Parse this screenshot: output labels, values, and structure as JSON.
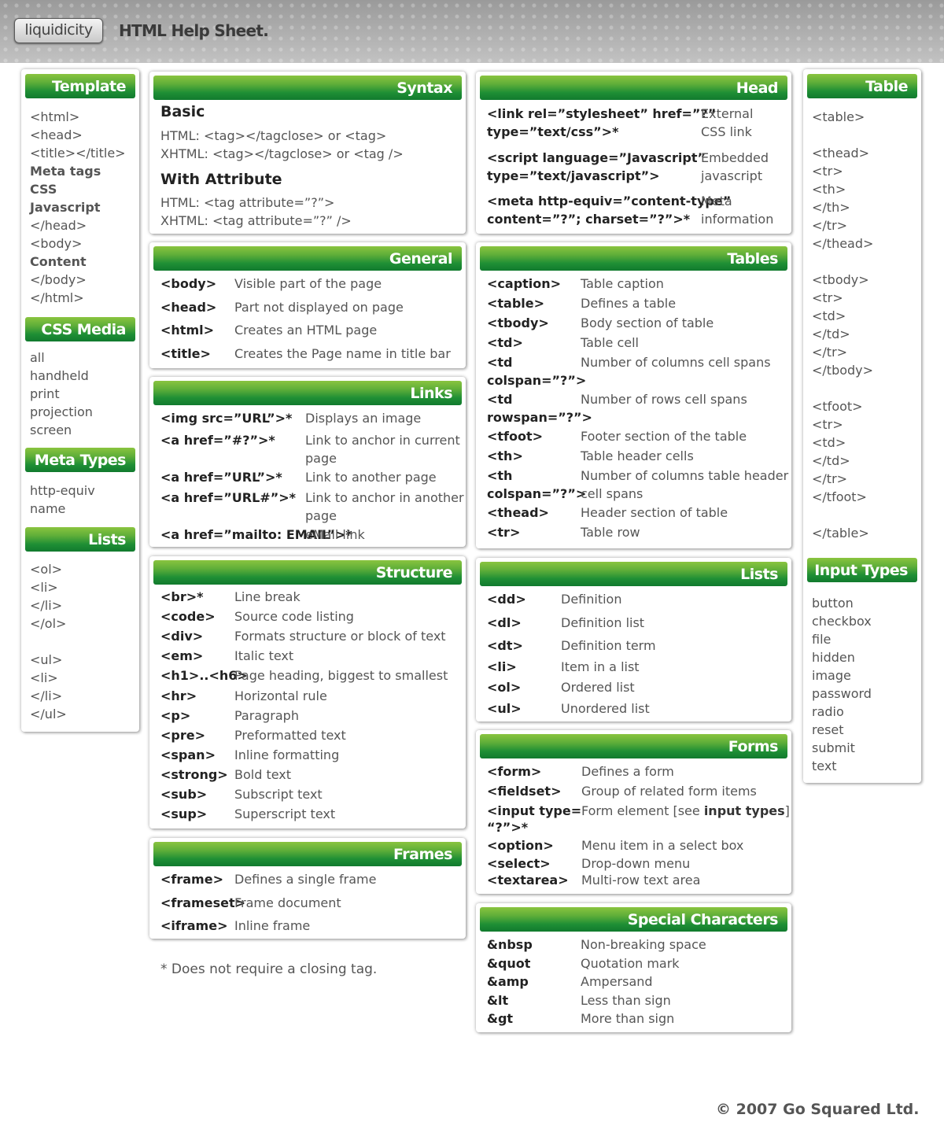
{
  "header": {
    "logo": "liquidicity",
    "title": "HTML Help Sheet."
  },
  "template": {
    "title": "Template",
    "items": [
      {
        "text": "<html>",
        "bold": false
      },
      {
        "text": "<head>",
        "bold": false
      },
      {
        "text": "<title></title>",
        "bold": false
      },
      {
        "text": "Meta tags",
        "bold": true
      },
      {
        "text": "CSS",
        "bold": true
      },
      {
        "text": "Javascript",
        "bold": true
      },
      {
        "text": "</head>",
        "bold": false
      },
      {
        "text": "<body>",
        "bold": false
      },
      {
        "text": "Content",
        "bold": true
      },
      {
        "text": "</body>",
        "bold": false
      },
      {
        "text": "</html>",
        "bold": false
      }
    ]
  },
  "css_media": {
    "title": "CSS Media",
    "items": [
      "all",
      "handheld",
      "print",
      "projection",
      "screen"
    ]
  },
  "meta_types": {
    "title": "Meta Types",
    "items": [
      "http-equiv",
      "name"
    ]
  },
  "lists_left": {
    "title": "Lists",
    "items": [
      "<ol>",
      "<li>",
      "</li>",
      "</ol>",
      "",
      "<ul>",
      "<li>",
      "</li>",
      "</ul>"
    ]
  },
  "syntax": {
    "title": "Syntax",
    "basic_heading": "Basic",
    "basic": [
      "HTML: <tag></tagclose> or <tag>",
      "XHTML: <tag></tagclose> or <tag />"
    ],
    "attr_heading": "With Attribute",
    "attr": [
      "HTML: <tag attribute=”?”>",
      "XHTML: <tag attribute=”?” />"
    ]
  },
  "general": {
    "title": "General",
    "rows": [
      {
        "tag": "<body>",
        "desc": "Visible part of the page"
      },
      {
        "tag": "<head>",
        "desc": "Part not displayed on page"
      },
      {
        "tag": "<html>",
        "desc": "Creates an HTML page"
      },
      {
        "tag": "<title>",
        "desc": "Creates the Page name in title bar"
      }
    ]
  },
  "links": {
    "title": "Links",
    "rows": [
      {
        "tag": "<img src=”URL”>*",
        "desc": "Displays an image"
      },
      {
        "tag": "<a href=”#?”>*",
        "desc": "Link to anchor in current",
        "desc2": "page"
      },
      {
        "tag": "<a href=”URL”>*",
        "desc": "Link to another page"
      },
      {
        "tag": "<a href=”URL#”>*",
        "desc": "Link to anchor in another",
        "desc2": "page"
      },
      {
        "tag": "<a href=”mailto: EMAIL”>*",
        "desc": "eMail link"
      }
    ]
  },
  "structure": {
    "title": "Structure",
    "rows": [
      {
        "tag": "<br>*",
        "desc": "Line break"
      },
      {
        "tag": "<code>",
        "desc": "Source code listing"
      },
      {
        "tag": "<div>",
        "desc": "Formats structure or block of text"
      },
      {
        "tag": "<em>",
        "desc": "Italic text"
      },
      {
        "tag": "<h1>..<h6>",
        "desc": "Page heading, biggest to smallest"
      },
      {
        "tag": "<hr>",
        "desc": "Horizontal rule"
      },
      {
        "tag": "<p>",
        "desc": "Paragraph"
      },
      {
        "tag": "<pre>",
        "desc": "Preformatted text"
      },
      {
        "tag": "<span>",
        "desc": "Inline formatting"
      },
      {
        "tag": "<strong>",
        "desc": "Bold text"
      },
      {
        "tag": "<sub>",
        "desc": "Subscript text"
      },
      {
        "tag": "<sup>",
        "desc": "Superscript text"
      }
    ]
  },
  "frames": {
    "title": "Frames",
    "rows": [
      {
        "tag": "<frame>",
        "desc": "Defines a single frame"
      },
      {
        "tag": "<frameset>",
        "desc": "Frame document"
      },
      {
        "tag": "<iframe>",
        "desc": "Inline frame"
      }
    ]
  },
  "footnote": "* Does not require a closing tag.",
  "head": {
    "title": "Head",
    "rows": [
      {
        "tag": "<link rel=”stylesheet” href=”?”",
        "tag2": "type=”text/css”>*",
        "desc": "External",
        "desc2": "CSS link"
      },
      {
        "tag": "<script language=”Javascript”",
        "tag2": "type=”text/javascript”>",
        "desc": "Embedded",
        "desc2": "javascript"
      },
      {
        "tag": "<meta http-equiv=”content-type”",
        "tag2": "content=”?”; charset=”?”>*",
        "desc": "Meta",
        "desc2": "information"
      }
    ]
  },
  "tables": {
    "title": "Tables",
    "rows": [
      {
        "tag": "<caption>",
        "desc": "Table caption"
      },
      {
        "tag": "<table>",
        "desc": "Defines a table"
      },
      {
        "tag": "<tbody>",
        "desc": "Body section of table"
      },
      {
        "tag": "<td>",
        "desc": "Table cell"
      },
      {
        "tag": "<td",
        "tag2": "colspan=”?”>",
        "desc": "Number of columns cell spans"
      },
      {
        "tag": "<td",
        "tag2": "rowspan=”?”>",
        "desc": "Number of rows cell spans"
      },
      {
        "tag": "<tfoot>",
        "desc": "Footer section of the table"
      },
      {
        "tag": "<th>",
        "desc": "Table header cells"
      },
      {
        "tag": "<th",
        "tag2": "colspan=”?”>",
        "desc": "Number of columns table header",
        "desc2": "cell spans"
      },
      {
        "tag": "<thead>",
        "desc": "Header section of table"
      },
      {
        "tag": "<tr>",
        "desc": "Table row"
      }
    ]
  },
  "lists_mid": {
    "title": "Lists",
    "rows": [
      {
        "tag": "<dd>",
        "desc": "Definition"
      },
      {
        "tag": "<dl>",
        "desc": "Definition list"
      },
      {
        "tag": "<dt>",
        "desc": "Definition term"
      },
      {
        "tag": "<li>",
        "desc": "Item in a list"
      },
      {
        "tag": "<ol>",
        "desc": "Ordered list"
      },
      {
        "tag": "<ul>",
        "desc": "Unordered list"
      }
    ]
  },
  "forms": {
    "title": "Forms",
    "rows": [
      {
        "tag": "<form>",
        "desc": "Defines a form"
      },
      {
        "tag": "<fieldset>",
        "desc": "Group of related form items"
      },
      {
        "tag": "<input type=",
        "tag2": "“?”>*",
        "desc": "Form element [see ",
        "desc_bold": "input types",
        "desc_end": "]"
      },
      {
        "tag": "<option>",
        "desc": "Menu item in a select box"
      },
      {
        "tag": "<select>",
        "desc": "Drop-down menu"
      },
      {
        "tag": "<textarea>",
        "desc": "Multi-row text area"
      }
    ]
  },
  "special": {
    "title": "Special Characters",
    "rows": [
      {
        "tag": "&nbsp",
        "desc": "Non-breaking space"
      },
      {
        "tag": "&quot",
        "desc": "Quotation mark"
      },
      {
        "tag": "&amp",
        "desc": "Ampersand"
      },
      {
        "tag": "&lt",
        "desc": "Less than sign"
      },
      {
        "tag": "&gt",
        "desc": "More than sign"
      }
    ]
  },
  "table_right": {
    "title": "Table",
    "items": [
      "<table>",
      "",
      "<thead>",
      "<tr>",
      "<th>",
      "</th>",
      "</tr>",
      "</thead>",
      "",
      "<tbody>",
      "<tr>",
      "<td>",
      "</td>",
      "</tr>",
      "</tbody>",
      "",
      "<tfoot>",
      "<tr>",
      "<td>",
      "</td>",
      "</tr>",
      "</tfoot>",
      "",
      "</table>"
    ]
  },
  "input_types": {
    "title": "Input Types",
    "items": [
      "button",
      "checkbox",
      "file",
      "hidden",
      "image",
      "password",
      "radio",
      "reset",
      "submit",
      "text"
    ]
  },
  "copyright": "© 2007 Go Squared Ltd."
}
